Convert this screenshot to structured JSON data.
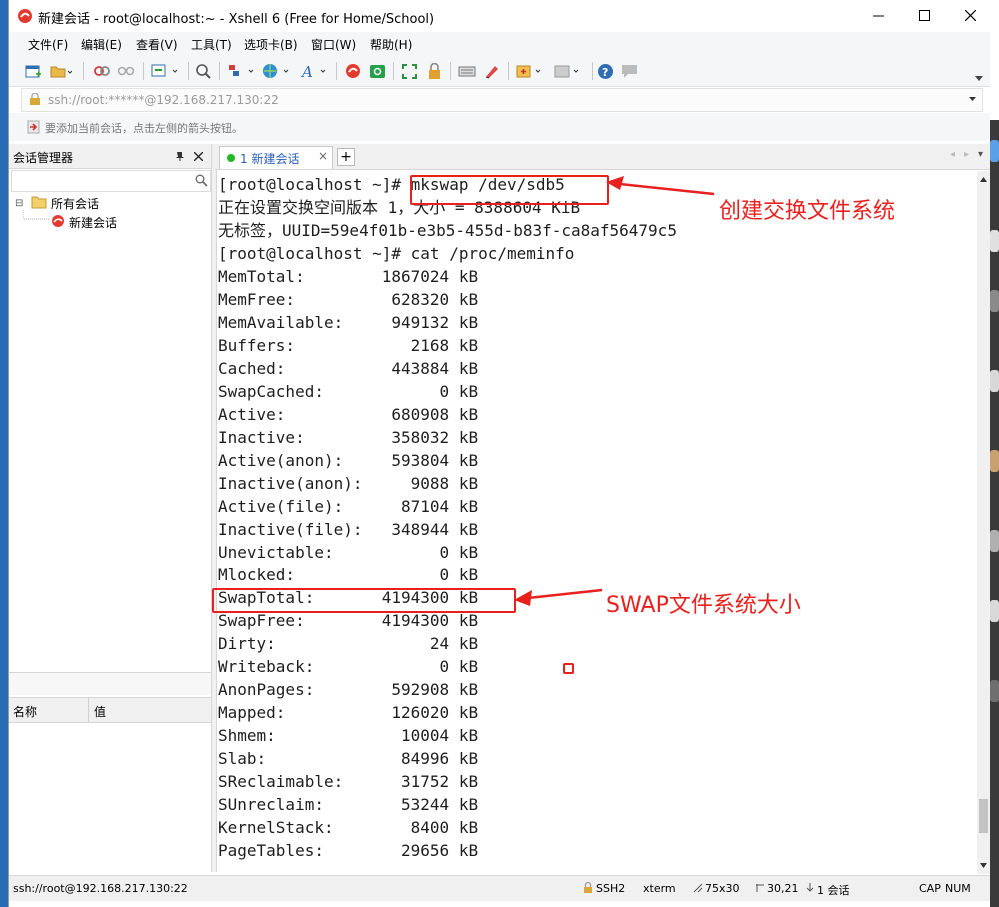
{
  "window": {
    "title": "新建会话 - root@localhost:~ - Xshell 6 (Free for Home/School)",
    "controls": {
      "minimize": "—",
      "maximize": "☐",
      "close": "✕"
    }
  },
  "menu": [
    "文件(F)",
    "编辑(E)",
    "查看(V)",
    "工具(T)",
    "选项卡(B)",
    "窗口(W)",
    "帮助(H)"
  ],
  "address": {
    "value": "ssh://root:******@192.168.217.130:22"
  },
  "hint": {
    "text": "要添加当前会话，点击左侧的箭头按钮。"
  },
  "session_manager": {
    "title": "会话管理器",
    "tree": {
      "root": "所有会话",
      "child": "新建会话"
    },
    "props_columns": [
      "名称",
      "值"
    ]
  },
  "tabs": [
    {
      "label": "1 新建会话",
      "close": "×"
    }
  ],
  "terminal": {
    "lines": [
      "[root@localhost ~]# mkswap /dev/sdb5",
      "正在设置交换空间版本 1，大小 = 8388604 KiB",
      "无标签，UUID=59e4f01b-e3b5-455d-b83f-ca8af56479c5",
      "[root@localhost ~]# cat /proc/meminfo",
      "MemTotal:        1867024 kB",
      "MemFree:          628320 kB",
      "MemAvailable:     949132 kB",
      "Buffers:            2168 kB",
      "Cached:           443884 kB",
      "SwapCached:            0 kB",
      "Active:           680908 kB",
      "Inactive:         358032 kB",
      "Active(anon):     593804 kB",
      "Inactive(anon):     9088 kB",
      "Active(file):      87104 kB",
      "Inactive(file):   348944 kB",
      "Unevictable:           0 kB",
      "Mlocked:               0 kB",
      "SwapTotal:       4194300 kB",
      "SwapFree:        4194300 kB",
      "Dirty:                24 kB",
      "Writeback:             0 kB",
      "AnonPages:        592908 kB",
      "Mapped:           126020 kB",
      "Shmem:             10004 kB",
      "Slab:              84996 kB",
      "SReclaimable:      31752 kB",
      "SUnreclaim:        53244 kB",
      "KernelStack:        8400 kB",
      "PageTables:        29656 kB"
    ]
  },
  "annotations": {
    "create_swap": "创建交换文件系统",
    "swap_size": "SWAP文件系统大小",
    "color": "#e8201e"
  },
  "status": {
    "connection": "ssh://root@192.168.217.130:22",
    "protocol": "SSH2",
    "terminal_type": "xterm",
    "size": "75x30",
    "cursor": "30,21",
    "sessions": "1 会话",
    "caps": "CAP",
    "num": "NUM"
  }
}
